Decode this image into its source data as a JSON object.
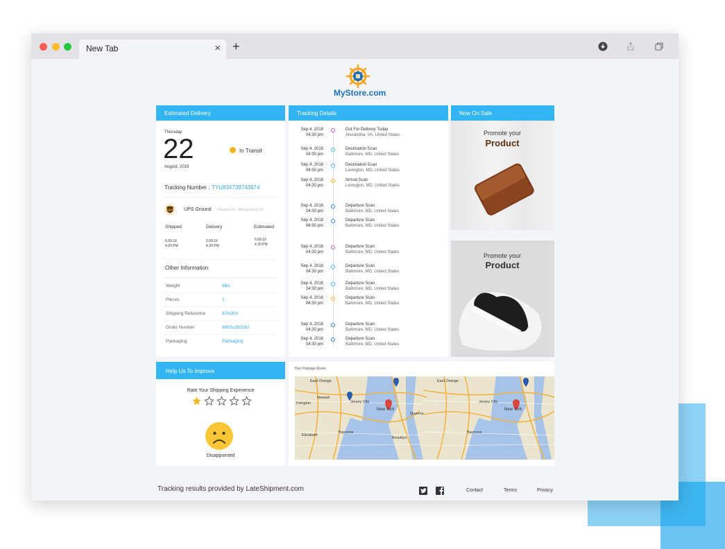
{
  "browser": {
    "tab_title": "New Tab",
    "tab_close": "×",
    "new_tab": "+"
  },
  "brand": {
    "name": "MyStore.com"
  },
  "estimated": {
    "header": "Estimated Delivery",
    "weekday": "Thursday",
    "day": "22",
    "month_year": "August, 2019",
    "status": "In Transit",
    "tracking_label": "Tracking Number :",
    "tracking_number": "TYU834738743874",
    "carrier": "UPS Ground",
    "carrier_route": "Orlando US - Montgomery US",
    "cols": [
      {
        "label": "Shipped",
        "date": "5.09.19",
        "time": "4.30 PM"
      },
      {
        "label": "Delivery",
        "date": "5.09.19",
        "time": "4.30 PM"
      },
      {
        "label": "Estimated",
        "date": "5.09.19",
        "time": "4.30 PM"
      }
    ],
    "other_title": "Other Information",
    "info": [
      {
        "label": "Weight",
        "value": "8lbs"
      },
      {
        "label": "Pieces",
        "value": "2"
      },
      {
        "label": "Shipping Reference",
        "value": "87HJK0"
      },
      {
        "label": "Order Number",
        "value": "8893u383282"
      },
      {
        "label": "Packaging",
        "value": "Packaging"
      }
    ]
  },
  "tracking": {
    "header": "Tracking Details",
    "events": [
      {
        "date": "Sep 4, 2018",
        "time": "04:30 pm",
        "title": "Out For Delivery Today",
        "loc": "Alexandria, VA, United States",
        "color": "#d94fd2"
      },
      {
        "date": "Sep 4, 2018",
        "time": "04:30 pm",
        "title": "Destination Scan",
        "loc": "Baltimore, MD, United States",
        "color": "#3bb3e6"
      },
      {
        "date": "Sep 4, 2018",
        "time": "04:30 pm",
        "title": "Destination Scan",
        "loc": "Lexington, MD, United States",
        "color": "#3bb3e6"
      },
      {
        "date": "Sep 4, 2018",
        "time": "04:30 pm",
        "title": "Arrival Scan",
        "loc": "Lexington, MD, United States",
        "color": "#f5a623"
      },
      {
        "date": "Sep 4, 2018",
        "time": "04:30 pm",
        "title": "Departure Scan",
        "loc": "Baltimore, MD, United States",
        "color": "#2f7de0"
      },
      {
        "date": "Sep 4, 2018",
        "time": "04:30 pm",
        "title": "Departure Scan",
        "loc": "Baltimore, MD, United States",
        "color": "#2f7de0"
      },
      {
        "date": "Sep 4, 2018",
        "time": "04:30 pm",
        "title": "Departure Scan",
        "loc": "Baltimore, MD, United States",
        "color": "#d94fd2"
      },
      {
        "date": "Sep 4, 2018",
        "time": "04:30 pm",
        "title": "Departure Scan",
        "loc": "Baltimore, MD, United States",
        "color": "#3bb3e6"
      },
      {
        "date": "Sep 4, 2018",
        "time": "04:30 pm",
        "title": "Departure Scan",
        "loc": "Baltimore, MD, United States",
        "color": "#3bb3e6"
      },
      {
        "date": "Sep 4, 2018",
        "time": "04:30 pm",
        "title": "Departure Scan",
        "loc": "Baltimore, MD, United States",
        "color": "#f5a623"
      },
      {
        "date": "Sep 4, 2018",
        "time": "04:30 pm",
        "title": "Departure Scan",
        "loc": "Baltimore, MD, United States",
        "color": "#2f7de0"
      },
      {
        "date": "Sep 4, 2018",
        "time": "04:30 pm",
        "title": "Departure Scan",
        "loc": "Baltimore, MD, United States",
        "color": "#2f7de0"
      }
    ]
  },
  "sale": {
    "header": "Now On Sale",
    "promos": [
      {
        "line1": "Promote your",
        "line2": "Product",
        "item": "wallet"
      },
      {
        "line1": "Promote your",
        "line2": "Product",
        "item": "sneaker"
      }
    ]
  },
  "improve": {
    "header": "Help Us To Improve",
    "prompt": "Rate Your Shipping Experience",
    "rating": 1,
    "max_rating": 5,
    "mood": "Disappointed"
  },
  "map": {
    "title": "Your Package Route",
    "labels": [
      "East Orange",
      "Newark",
      "Jersey City",
      "New York",
      "Irvington",
      "Elizabeth",
      "Bayonne",
      "Brooklyn",
      "Queens",
      "East Orange",
      "Jersey City",
      "New York",
      "Bayonne"
    ]
  },
  "footer": {
    "credit": "Tracking results provided by LateShipment.com",
    "links": [
      "Contact",
      "Terms",
      "Privacy"
    ]
  },
  "colors": {
    "accent": "#33b5f3",
    "link": "#33a8e9",
    "status_dot": "#f5b41d",
    "star": "#f5b41d",
    "emoji": "#f9c638"
  }
}
